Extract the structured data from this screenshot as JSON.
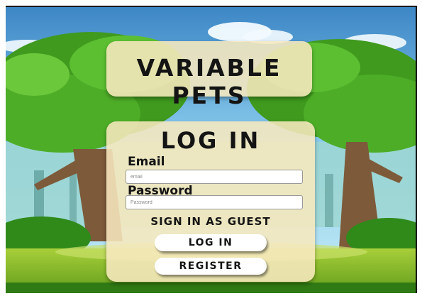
{
  "header": {
    "title": "VARIABLE PETS"
  },
  "login": {
    "heading": "LOG IN",
    "email_label": "Email",
    "email_placeholder": "email",
    "password_label": "Password",
    "password_placeholder": "Password",
    "guest_label": "SIGN IN AS GUEST",
    "login_label": "LOG IN",
    "register_label": "REGISTER"
  },
  "colors": {
    "panel": "#f7e8be",
    "text": "#141414",
    "sky": "#8fd0ef",
    "foliage": "#3f9a1e",
    "ground": "#7ab51e"
  }
}
